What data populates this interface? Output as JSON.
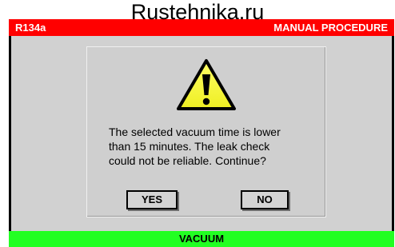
{
  "watermark": "Rustehnika.ru",
  "header": {
    "refrigerant": "R134a",
    "mode": "MANUAL PROCEDURE"
  },
  "dialog": {
    "icon": "warning-icon",
    "message_lines": [
      "The selected vacuum time is lower",
      "than 15 minutes. The leak check",
      "could not be reliable. Continue?"
    ],
    "yes_label": "YES",
    "no_label": "NO"
  },
  "footer": {
    "phase": "VACUUM"
  },
  "colors": {
    "header_bg": "#ff0000",
    "footer_bg": "#22ff22",
    "screen_bg": "#d1d1d1",
    "warning_yellow": "#ffff33"
  }
}
